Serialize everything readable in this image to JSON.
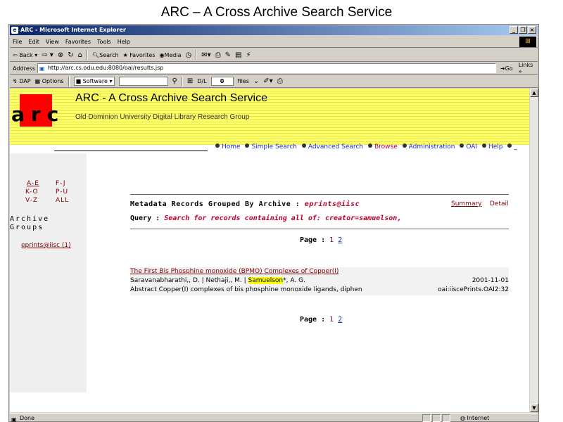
{
  "slide_title": "ARC – A Cross Archive Search Service",
  "window": {
    "title": "ARC - Microsoft Internet Explorer",
    "menu": [
      "File",
      "Edit",
      "View",
      "Favorites",
      "Tools",
      "Help"
    ],
    "toolbar": {
      "back": "Back",
      "search": "Search",
      "favorites": "Favorites",
      "media": "Media"
    },
    "address": {
      "label": "Address",
      "url": "http://arc.cs.odu.edu:8080/oai/results.jsp",
      "go": "Go",
      "links": "Links"
    },
    "dapbar": {
      "dap": "DAP",
      "options": "Options",
      "software": "Software",
      "dl_label": "D/L",
      "dl_value": "0",
      "files": "files"
    },
    "status": {
      "text": "Done",
      "zone": "Internet"
    }
  },
  "site": {
    "logo": "arc",
    "title": "ARC - A Cross Archive Search Service",
    "subtitle": "Old Dominion University Digital Library Research Group",
    "nav": [
      "Home",
      "Simple Search",
      "Advanced Search",
      "Browse",
      "Administration",
      "OAI",
      "Help"
    ]
  },
  "sidebar": {
    "alpha": [
      "A-E",
      "F-J",
      "K-O",
      "P-U",
      "V-Z",
      "ALL"
    ],
    "heading_line1": "Archive",
    "heading_line2": "Groups",
    "group_link": "eprints@iisc (1)"
  },
  "results": {
    "heading": "Metadata Records Grouped By Archive :",
    "archive": "eprints@iisc",
    "summary": "Summary",
    "detail": "Detail",
    "query_label": "Query :",
    "query_text": "Search for records containing all of: creator=samuelson,",
    "page_label": "Page :",
    "pages": [
      "1",
      "2"
    ],
    "record": {
      "title": "The First Bis Phosphine monoxide (BPMO) Complexes of Copper(I)",
      "authors_before": "Saravanabharathi,, D. | Nethaji,, M. | ",
      "author_highlight": "Samuelson",
      "authors_after": "*, A. G.",
      "date": "2001-11-01",
      "abstract": "Abstract Copper(I) complexes of bis phosphine monoxide ligands, diphen",
      "oai_id": "oai:iiscePrints.OAI2:32"
    }
  }
}
